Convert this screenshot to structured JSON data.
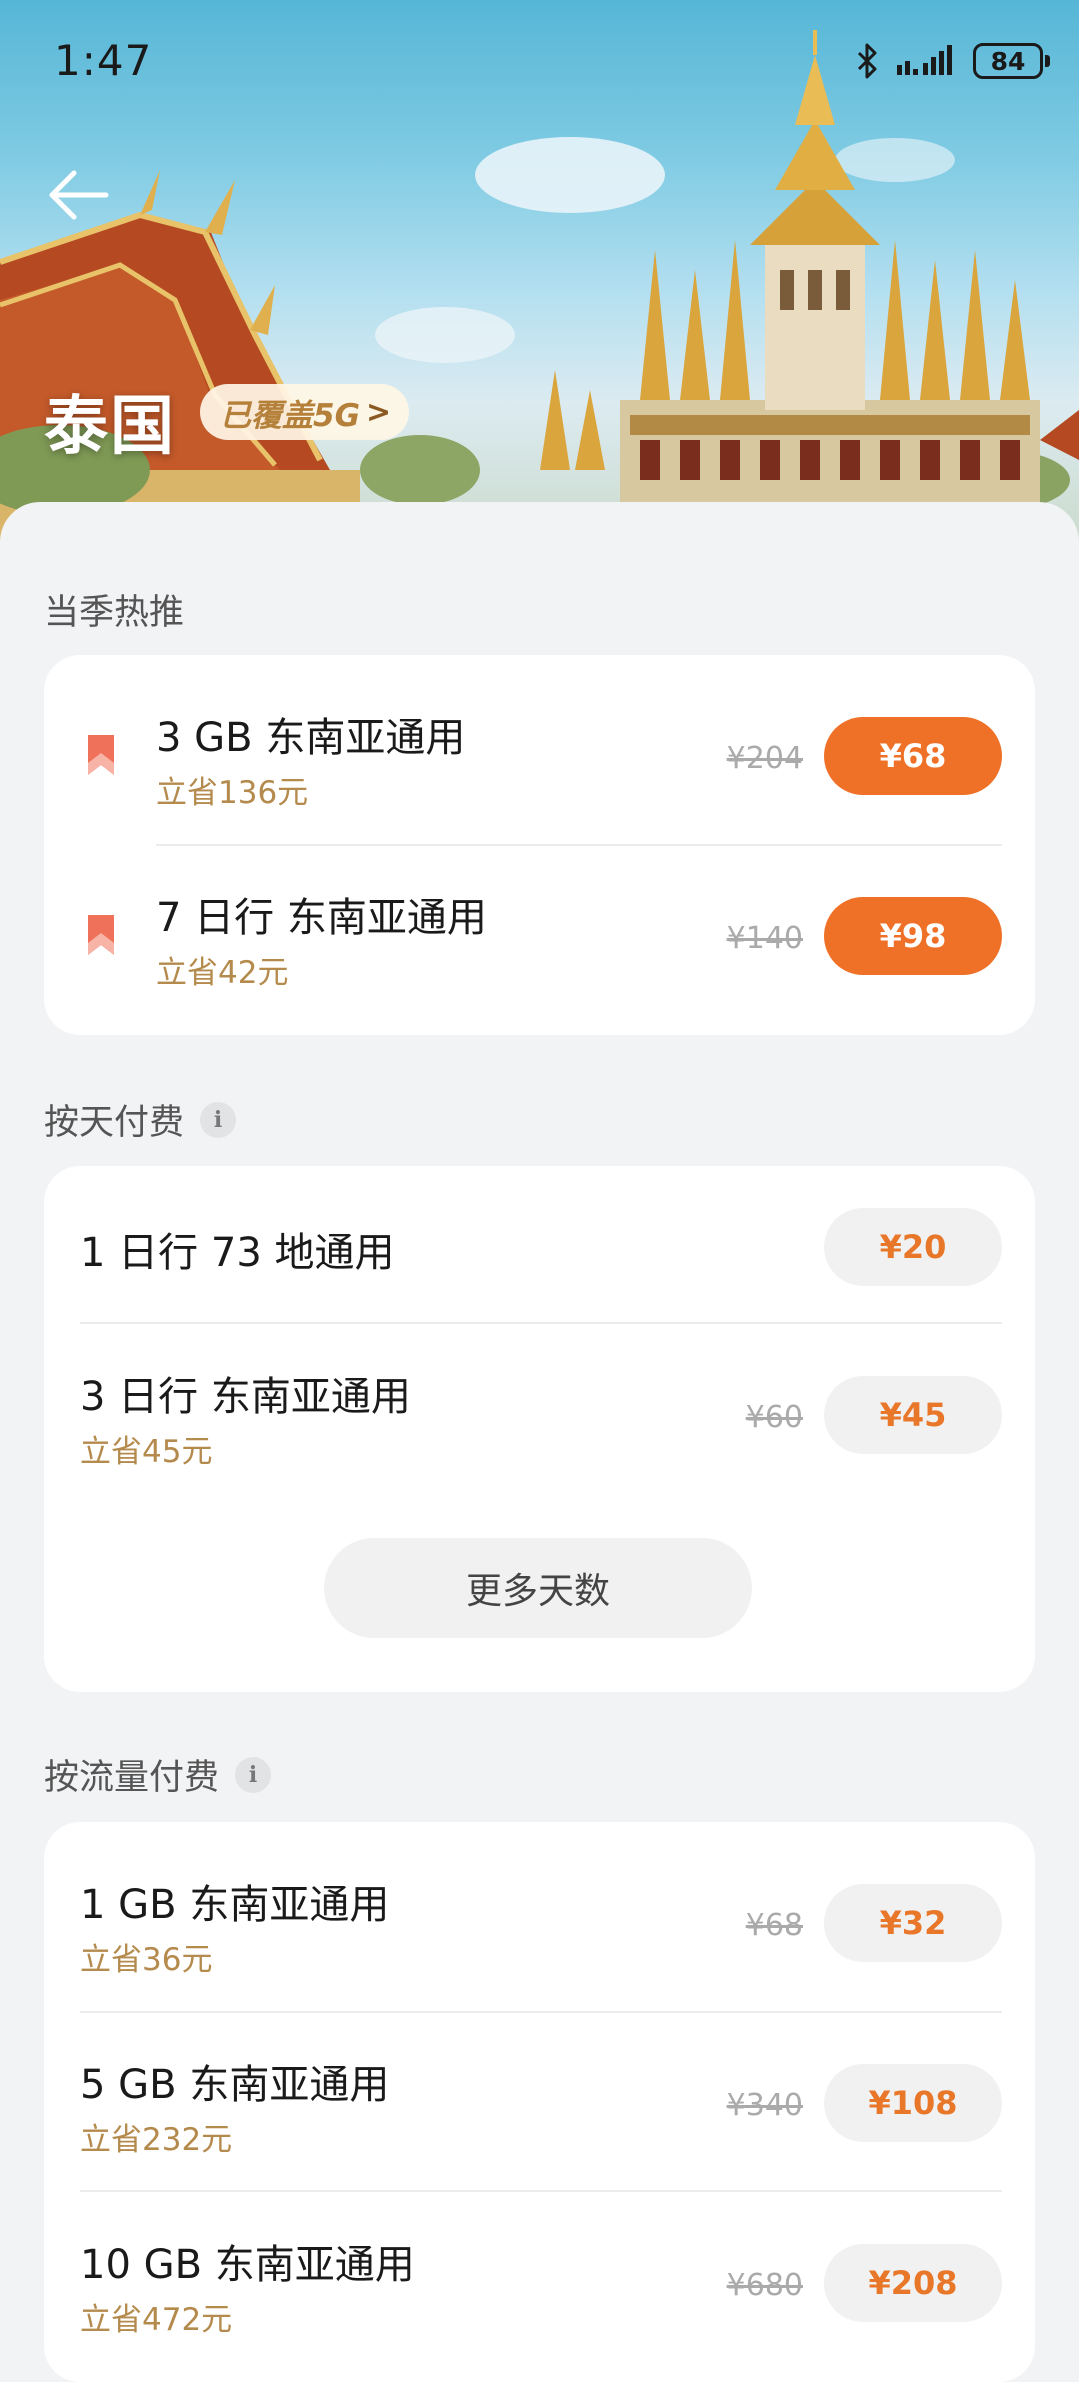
{
  "status_bar": {
    "time": "1:47",
    "battery": "84"
  },
  "header": {
    "country": "泰国",
    "coverage_badge": "已覆盖5G",
    "coverage_chevron": ">"
  },
  "hot": {
    "title": "当季热推",
    "items": [
      {
        "name": "3 GB 东南亚通用",
        "save": "立省136元",
        "original": "¥204",
        "price": "¥68"
      },
      {
        "name": "7 日行 东南亚通用",
        "save": "立省42元",
        "original": "¥140",
        "price": "¥98"
      }
    ]
  },
  "daily": {
    "title": "按天付费",
    "info_icon": "i",
    "items": [
      {
        "name": "1 日行  73 地通用",
        "price": "¥20"
      },
      {
        "name": "3 日行 东南亚通用",
        "save": "立省45元",
        "original": "¥60",
        "price": "¥45"
      }
    ],
    "more_label": "更多天数"
  },
  "traffic": {
    "title": "按流量付费",
    "info_icon": "i",
    "items": [
      {
        "name": "1 GB 东南亚通用",
        "save": "立省36元",
        "original": "¥68",
        "price": "¥32"
      },
      {
        "name": "5 GB 东南亚通用",
        "save": "立省232元",
        "original": "¥340",
        "price": "¥108"
      },
      {
        "name": "10 GB 东南亚通用",
        "save": "立省472元",
        "original": "¥680",
        "price": "¥208"
      }
    ]
  },
  "colors": {
    "accent": "#ef7127",
    "save_text": "#b58a4d",
    "background": "#f2f3f5"
  }
}
